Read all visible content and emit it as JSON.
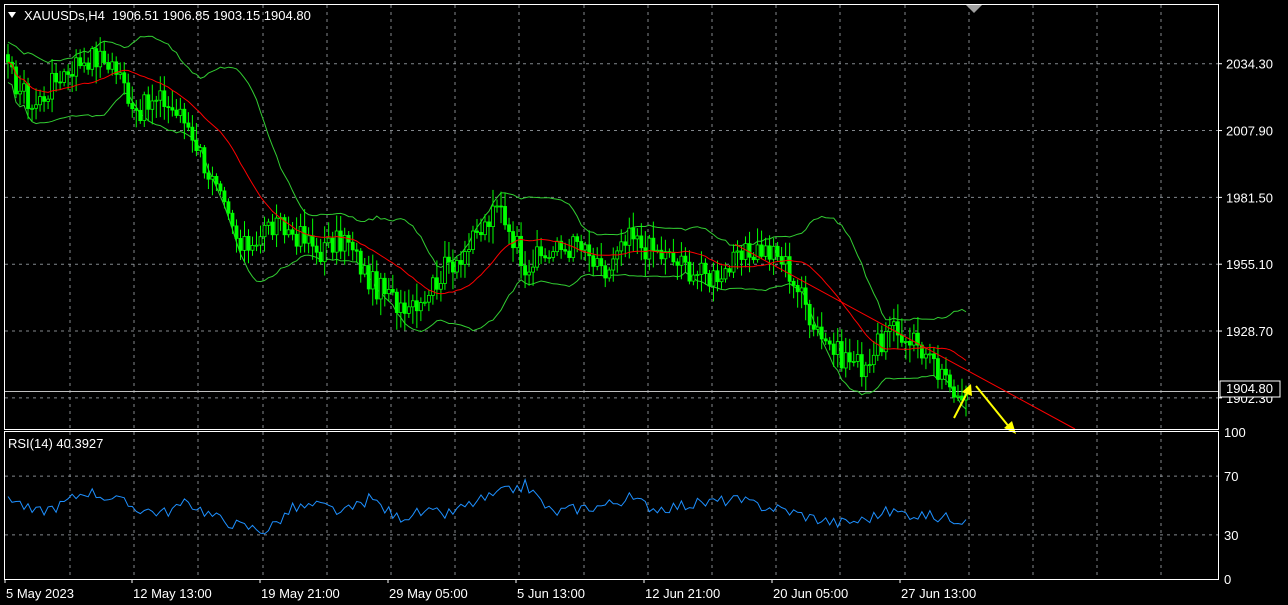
{
  "header": {
    "title": "XAUUSDs,H4",
    "ohlc": "1906.51 1906.85 1903.15 1904.80"
  },
  "rsi_header": "RSI(14) 40.3927",
  "price_axis": {
    "ticks": [
      "2034.30",
      "2007.90",
      "1981.50",
      "1955.10",
      "1928.70",
      "1902.30"
    ],
    "current_label": "1904.80"
  },
  "rsi_axis": {
    "ticks": [
      "100",
      "70",
      "30",
      "0"
    ]
  },
  "time_axis": {
    "labels": [
      "5 May 2023",
      "12 May 13:00",
      "19 May 21:00",
      "29 May 05:00",
      "5 Jun 13:00",
      "12 Jun 21:00",
      "20 Jun 05:00",
      "27 Jun 13:00"
    ]
  },
  "colors": {
    "candle": "#00ff00",
    "ma": "#ff0000",
    "bands": "#32cd32",
    "rsi": "#1e90ff",
    "trendline": "#ff0000",
    "arrow": "#ffff00",
    "grid": "#9aa0a6"
  },
  "chart_data": [
    {
      "type": "candlestick",
      "symbol": "XAUUSDs",
      "timeframe": "H4",
      "indicators": [
        "Bollinger Bands",
        "Moving Average"
      ],
      "ylim": [
        1890.0,
        2057.5
      ],
      "x_labels": [
        "5 May 2023",
        "12 May 13:00",
        "19 May 21:00",
        "29 May 05:00",
        "5 Jun 13:00",
        "12 Jun 21:00",
        "20 Jun 05:00",
        "27 Jun 13:00"
      ],
      "close_path": [
        [
          "5 May 2023",
          2031
        ],
        [
          "7 May",
          2017
        ],
        [
          "9 May",
          2030
        ],
        [
          "10 May",
          2037
        ],
        [
          "11 May",
          2035
        ],
        [
          "12 May 13:00",
          2016
        ],
        [
          "15 May",
          2020
        ],
        [
          "16 May",
          2010
        ],
        [
          "17 May",
          1985
        ],
        [
          "18 May",
          1960
        ],
        [
          "19 May 21:00",
          1970
        ],
        [
          "22 May",
          1968
        ],
        [
          "23 May",
          1960
        ],
        [
          "24 May",
          1965
        ],
        [
          "25 May",
          1948
        ],
        [
          "26 May",
          1940
        ],
        [
          "29 May 05:00",
          1942
        ],
        [
          "30 May",
          1955
        ],
        [
          "31 May",
          1964
        ],
        [
          "1 Jun",
          1978
        ],
        [
          "2 Jun",
          1955
        ],
        [
          "5 Jun 13:00",
          1960
        ],
        [
          "6 Jun",
          1963
        ],
        [
          "7 Jun",
          1950
        ],
        [
          "8 Jun",
          1965
        ],
        [
          "9 Jun",
          1960
        ],
        [
          "12 Jun 21:00",
          1955
        ],
        [
          "13 Jun",
          1950
        ],
        [
          "14 Jun",
          1955
        ],
        [
          "15 Jun",
          1962
        ],
        [
          "16 Jun",
          1956
        ],
        [
          "20 Jun 05:00",
          1935
        ],
        [
          "21 Jun",
          1920
        ],
        [
          "22 Jun",
          1915
        ],
        [
          "23 Jun",
          1928
        ],
        [
          "26 Jun",
          1926
        ],
        [
          "27 Jun 13:00",
          1910
        ],
        [
          "28 Jun",
          1904.8
        ]
      ],
      "trendline": {
        "from": [
          "20 Jun",
          1963
        ],
        "to": [
          "30 Jun",
          1890
        ]
      },
      "annotations": [
        "yellow arrow up at latest bar",
        "yellow arrow pointing down beyond trendline"
      ],
      "current_price": 1904.8,
      "grid": true
    },
    {
      "type": "line",
      "name": "RSI(14)",
      "last_value": 40.3927,
      "ylim": [
        0,
        100
      ],
      "levels": [
        70,
        30
      ],
      "values": [
        57,
        45,
        50,
        60,
        55,
        48,
        45,
        52,
        42,
        36,
        33,
        48,
        50,
        45,
        55,
        42,
        45,
        44,
        52,
        58,
        64,
        45,
        48,
        50,
        55,
        48,
        50,
        52,
        54,
        50,
        47,
        42,
        38,
        40,
        46,
        44,
        42,
        40.4
      ],
      "grid": true
    }
  ]
}
